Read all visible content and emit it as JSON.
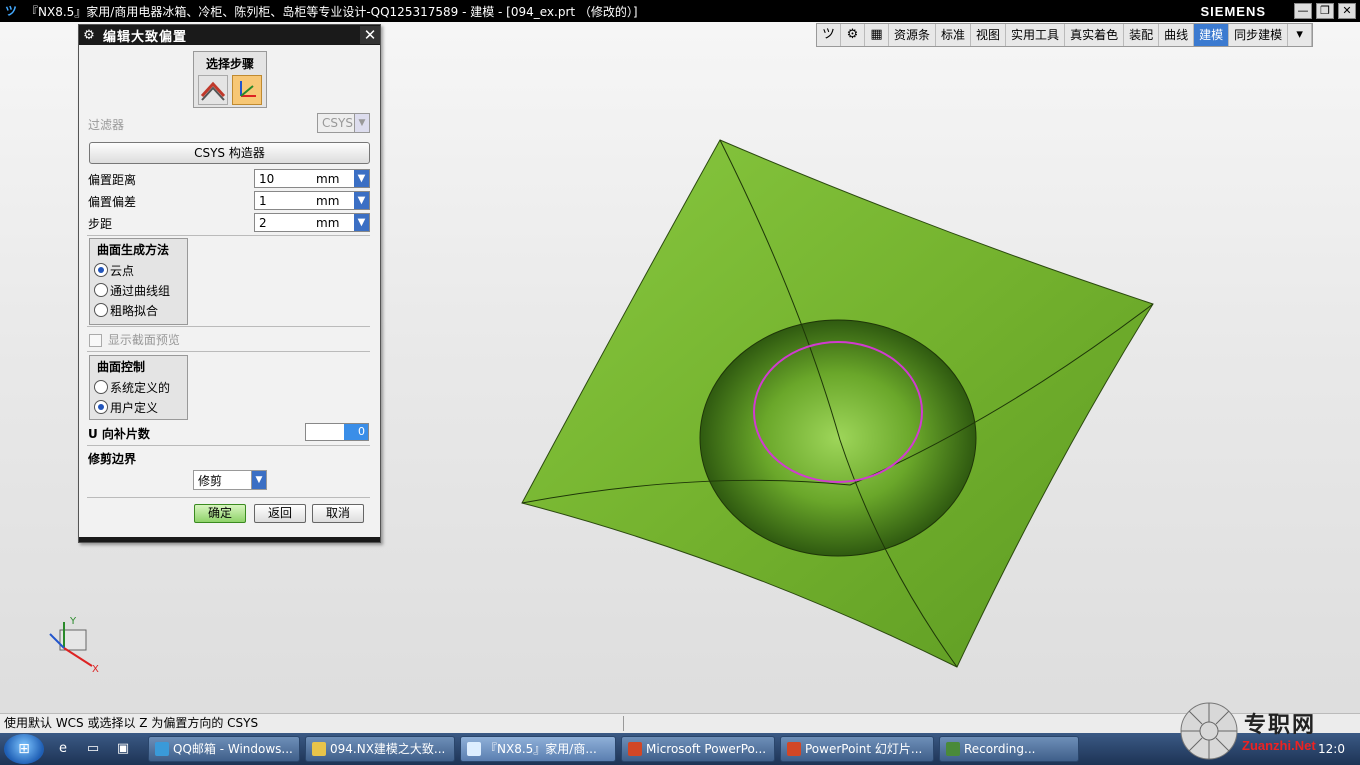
{
  "window": {
    "title": "『NX8.5』家用/商用电器冰箱、冷柜、陈列柜、岛柜等专业设计-QQ125317589 - 建模 - [094_ex.prt （修改的）]",
    "brand": "SIEMENS",
    "minimize": "—",
    "restore": "❐",
    "close": "✕"
  },
  "toolbar": {
    "tabs": [
      {
        "label": "资源条"
      },
      {
        "label": "标准"
      },
      {
        "label": "视图"
      },
      {
        "label": "实用工具"
      },
      {
        "label": "真实着色"
      },
      {
        "label": "装配"
      },
      {
        "label": "曲线"
      },
      {
        "label": "建模",
        "active": true
      },
      {
        "label": "同步建模"
      }
    ]
  },
  "dialog": {
    "title": "编辑大致偏置",
    "close": "✕",
    "select_steps_label": "选择步骤",
    "filter_label": "过滤器",
    "filter_value": "CSYS",
    "csys_button": "CSYS 构造器",
    "fields": [
      {
        "label": "偏置距离",
        "value": "10",
        "unit": "mm"
      },
      {
        "label": "偏置偏差",
        "value": "1",
        "unit": "mm"
      },
      {
        "label": "步距",
        "value": "2",
        "unit": "mm"
      }
    ],
    "surface_method": {
      "title": "曲面生成方法",
      "options": [
        "云点",
        "通过曲线组",
        "粗略拟合"
      ],
      "selected": 0
    },
    "show_section_preview": "显示截面预览",
    "surface_control": {
      "title": "曲面控制",
      "options": [
        "系统定义的",
        "用户定义"
      ],
      "selected": 1
    },
    "u_patches_label": "U 向补片数",
    "u_patches_value": "0",
    "trim_boundary_label": "修剪边界",
    "trim_value": "修剪",
    "ok": "确定",
    "back": "返回",
    "cancel": "取消"
  },
  "status": {
    "prompt": "使用默认 WCS 或选择以 Z 为偏置方向的 CSYS"
  },
  "axes": {
    "x": "X",
    "y": "Y"
  },
  "taskbar": {
    "tasks": [
      {
        "label": "QQ邮箱 - Windows..."
      },
      {
        "label": "094.NX建模之大致..."
      },
      {
        "label": "『NX8.5』家用/商..."
      },
      {
        "label": "Microsoft PowerPo..."
      },
      {
        "label": "PowerPoint 幻灯片..."
      },
      {
        "label": "Recording..."
      }
    ],
    "clock": "12:0"
  },
  "watermark": {
    "text": "专职网",
    "url": "Zuanzhi.Net"
  },
  "colors": {
    "surface": "#77b52c",
    "highlight_circle": "#d13bd0",
    "active_tab": "#3b7ad0"
  }
}
